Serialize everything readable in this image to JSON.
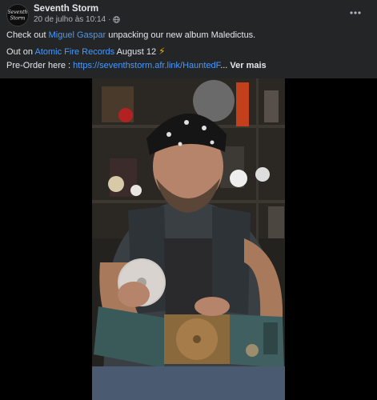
{
  "page": {
    "name": "Seventh Storm",
    "date": "20 de julho às 10:14",
    "avatar_text_line1": "Seventh",
    "avatar_text_line2": "Storm"
  },
  "post": {
    "line1_prefix": "Check out ",
    "line1_link": "Miguel Gaspar",
    "line1_suffix": " unpacking our new album Maledictus.",
    "line2_prefix": "Out on ",
    "line2_link": "Atomic Fire Records",
    "line2_suffix": " August 12 ",
    "line3_prefix": "Pre-Order here : ",
    "line3_link": "https://seventhstorm.afr.link/HauntedF",
    "line3_ellipsis": "...",
    "see_more": "Ver mais"
  },
  "icons": {
    "globe": "globe-icon",
    "more": "more-options-icon",
    "lightning": "lightning-emoji"
  },
  "colors": {
    "header_bg": "#242526",
    "link": "#4599ff",
    "text": "#e4e6eb",
    "meta": "#b0b3b8"
  }
}
